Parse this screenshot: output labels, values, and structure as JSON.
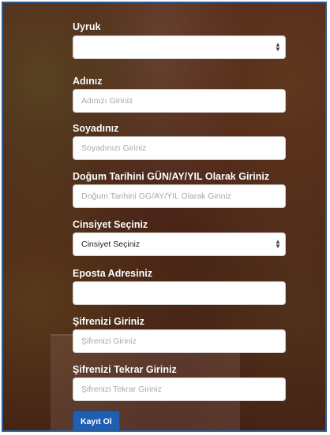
{
  "form": {
    "nationality": {
      "label": "Uyruk",
      "value": ""
    },
    "first_name": {
      "label": "Adınız",
      "placeholder": "Adınızı Giriniz"
    },
    "last_name": {
      "label": "Soyadınız",
      "placeholder": "Soyadınızı Giriniz"
    },
    "birth_date": {
      "label": "Doğum Tarihini GÜN/AY/YIL Olarak Giriniz",
      "placeholder": "Doğum Tarihini GG/AY/YIL Olarak Giriniz"
    },
    "gender": {
      "label": "Cinsiyet Seçiniz",
      "value": "Cinsiyet Seçiniz"
    },
    "email": {
      "label": "Eposta Adresiniz",
      "placeholder": ""
    },
    "password": {
      "label": "Şifrenizi Giriniz",
      "placeholder": "Şifrenizi Giriniz"
    },
    "password_repeat": {
      "label": "Şifrenizi Tekrar Giriniz",
      "placeholder": "Şifrenizi Tekrar Giriniz"
    },
    "submit_label": "Kayıt Ol"
  },
  "icons": {
    "select_caret": "select-caret-icon"
  },
  "colors": {
    "button": "#1f5fb3",
    "frame_border": "#2f5d93",
    "background": "#4a2418"
  }
}
